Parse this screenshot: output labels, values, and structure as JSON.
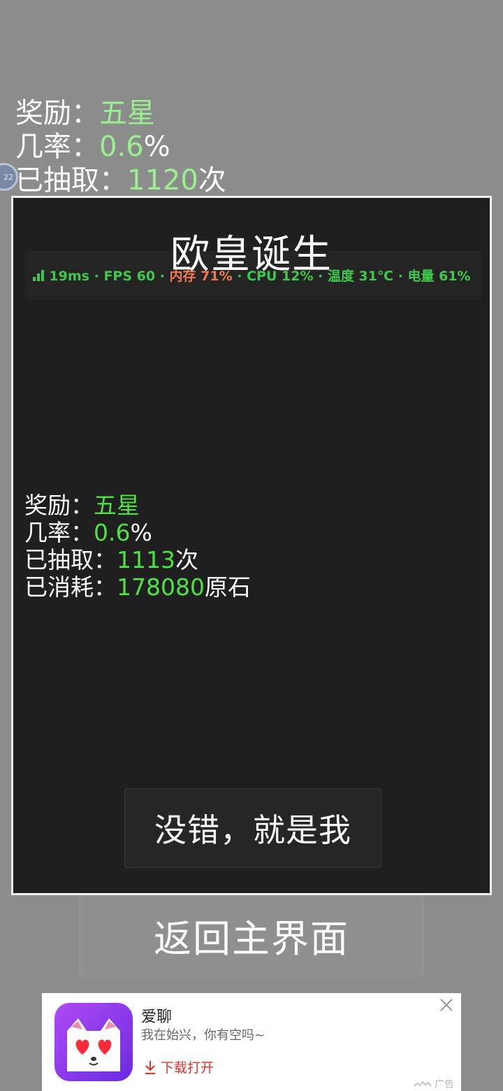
{
  "background": {
    "stats": {
      "reward_label": "奖励：",
      "reward_value": "五星",
      "rate_label": "几率：",
      "rate_value": "0.6",
      "rate_suffix": "%",
      "drawn_label": "已抽取：",
      "drawn_value": "1120",
      "drawn_suffix": "次"
    },
    "floating_ball_text": "22",
    "return_button": "返回主界面"
  },
  "dialog": {
    "title": "欧皇诞生",
    "perf": {
      "latency": "19ms",
      "fps": "FPS 60",
      "memory": "内存 71%",
      "cpu": "CPU 12%",
      "temperature": "温度 31℃",
      "battery": "电量 61%",
      "sep": " · "
    },
    "stats": {
      "reward_label": "奖励：",
      "reward_value": "五星",
      "rate_label": "几率：",
      "rate_value": "0.6",
      "rate_suffix": "%",
      "drawn_label": "已抽取：",
      "drawn_value": "1113",
      "drawn_suffix": "次",
      "spent_label": "已消耗：",
      "spent_value": "178080",
      "spent_suffix": "原石"
    },
    "confirm_button": "没错，就是我"
  },
  "ad": {
    "title": "爱聊",
    "subtitle": "我在始兴，你有空吗~",
    "download": "下载打开",
    "mark": "广告"
  },
  "colors": {
    "highlight_bg": "#9af08f",
    "highlight_dialog": "#4ee244",
    "perf_ok": "#3dc84b",
    "perf_warn": "#f0784f",
    "ad_accent": "#e0322c"
  }
}
